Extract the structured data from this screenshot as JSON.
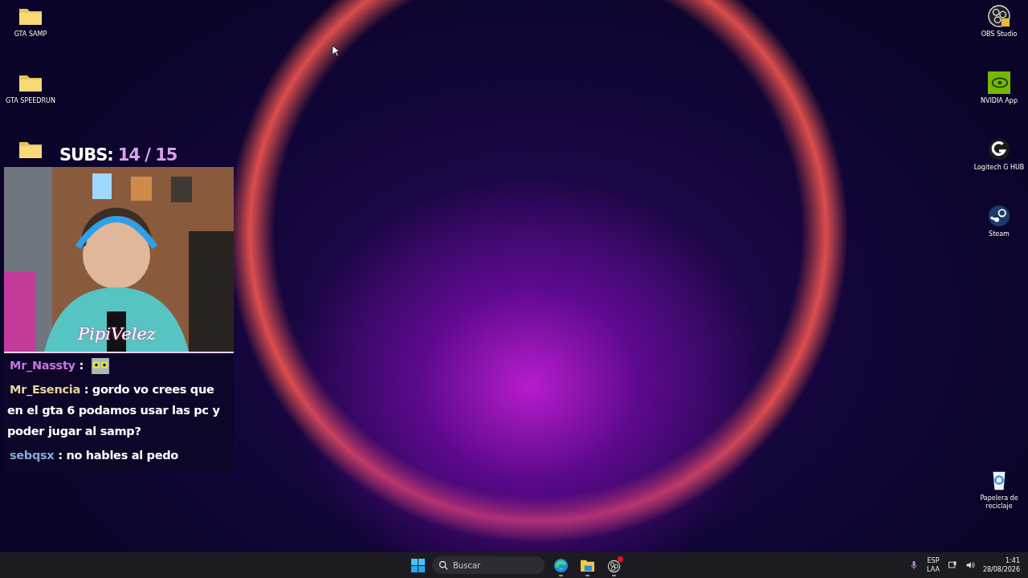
{
  "desktop": {
    "left_icons": [
      {
        "label": "GTA SAMP",
        "kind": "folder"
      },
      {
        "label": "GTA SPEEDRUN",
        "kind": "folder"
      },
      {
        "kind": "folder"
      }
    ],
    "right_icons": [
      {
        "label": "OBS Studio",
        "kind": "obs"
      },
      {
        "label": "NVIDIA App",
        "kind": "nvidia"
      },
      {
        "label": "Logitech G HUB",
        "kind": "ghub"
      },
      {
        "label": "Steam",
        "kind": "steam"
      }
    ],
    "bottom_icon": {
      "label": "Papelera de reciclaje",
      "kind": "recycle"
    }
  },
  "overlay": {
    "subs_label": "SUBS:",
    "subs_count": "14 / 15",
    "signature": "PipiVelez",
    "chat": [
      {
        "user": "Mr_Nassty",
        "color": "#c773e0",
        "kind": "emote",
        "text": ":"
      },
      {
        "user": "Mr_Esencia",
        "color": "#e6d39c",
        "kind": "text",
        "text": ": gordo vo crees que en el gta 6 podamos usar las pc y poder jugar al samp?"
      },
      {
        "user": "sebqsx",
        "color": "#86a9d6",
        "kind": "text",
        "text": ": no hables al pedo"
      }
    ]
  },
  "taskbar": {
    "search": {
      "placeholder": "Buscar"
    },
    "apps": [
      {
        "kind": "edge",
        "notification": false
      },
      {
        "kind": "explorer",
        "notification": false
      },
      {
        "kind": "obs",
        "notification": true
      }
    ],
    "tray": {
      "language": "ESP",
      "layout": "LAA",
      "time": "1:41",
      "date": "28/08/2026"
    }
  }
}
